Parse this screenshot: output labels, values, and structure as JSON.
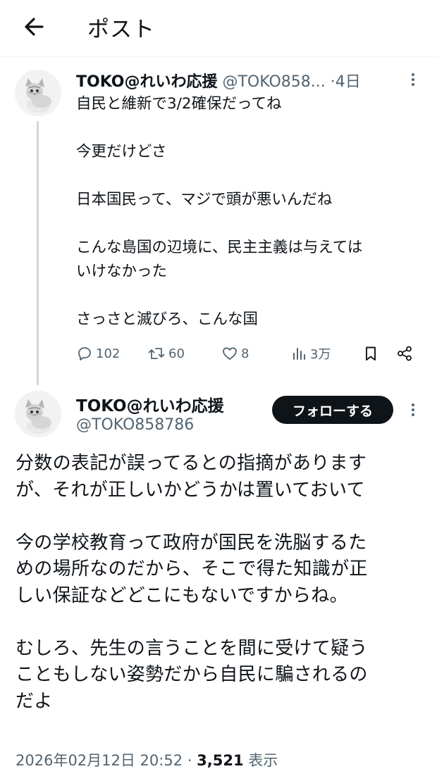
{
  "header": {
    "title": "ポスト"
  },
  "parent_post": {
    "display_name": "TOKO@れいわ応援",
    "handle": "@TOKO858...",
    "separator": "·",
    "time": "4日",
    "text": "自民と維新で3/2確保だってね\n\n今更だけどさ\n\n日本国民って、マジで頭が悪いんだね\n\nこんな島国の辺境に、民主主義は与えては\nいけなかった\n\nさっさと滅びろ、こんな国",
    "replies": "102",
    "reposts": "60",
    "likes": "8",
    "views": "3万"
  },
  "main_post": {
    "display_name": "TOKO@れいわ応援",
    "handle": "@TOKO858786",
    "follow_label": "フォローする",
    "text": "分数の表記が誤ってるとの指摘があります\nが、それが正しいかどうかは置いておいて\n\n今の学校教育って政府が国民を洗脳するた\nめの場所なのだから、そこで得た知識が正\nしい保証などどこにもないですからね。\n\nむしろ、先生の言うことを間に受けて疑う\nこともしない姿勢だから自民に騙されるの\nだよ",
    "timestamp": "2026年02月12日 20:52",
    "separator": "·",
    "views_count": "3,521",
    "views_label": "表示"
  },
  "icons": {
    "back": "arrow-left-icon",
    "more": "more-vertical-icon",
    "reply": "reply-icon",
    "repost": "repost-icon",
    "like": "heart-icon",
    "views": "analytics-icon",
    "bookmark": "bookmark-icon",
    "share": "share-icon"
  }
}
